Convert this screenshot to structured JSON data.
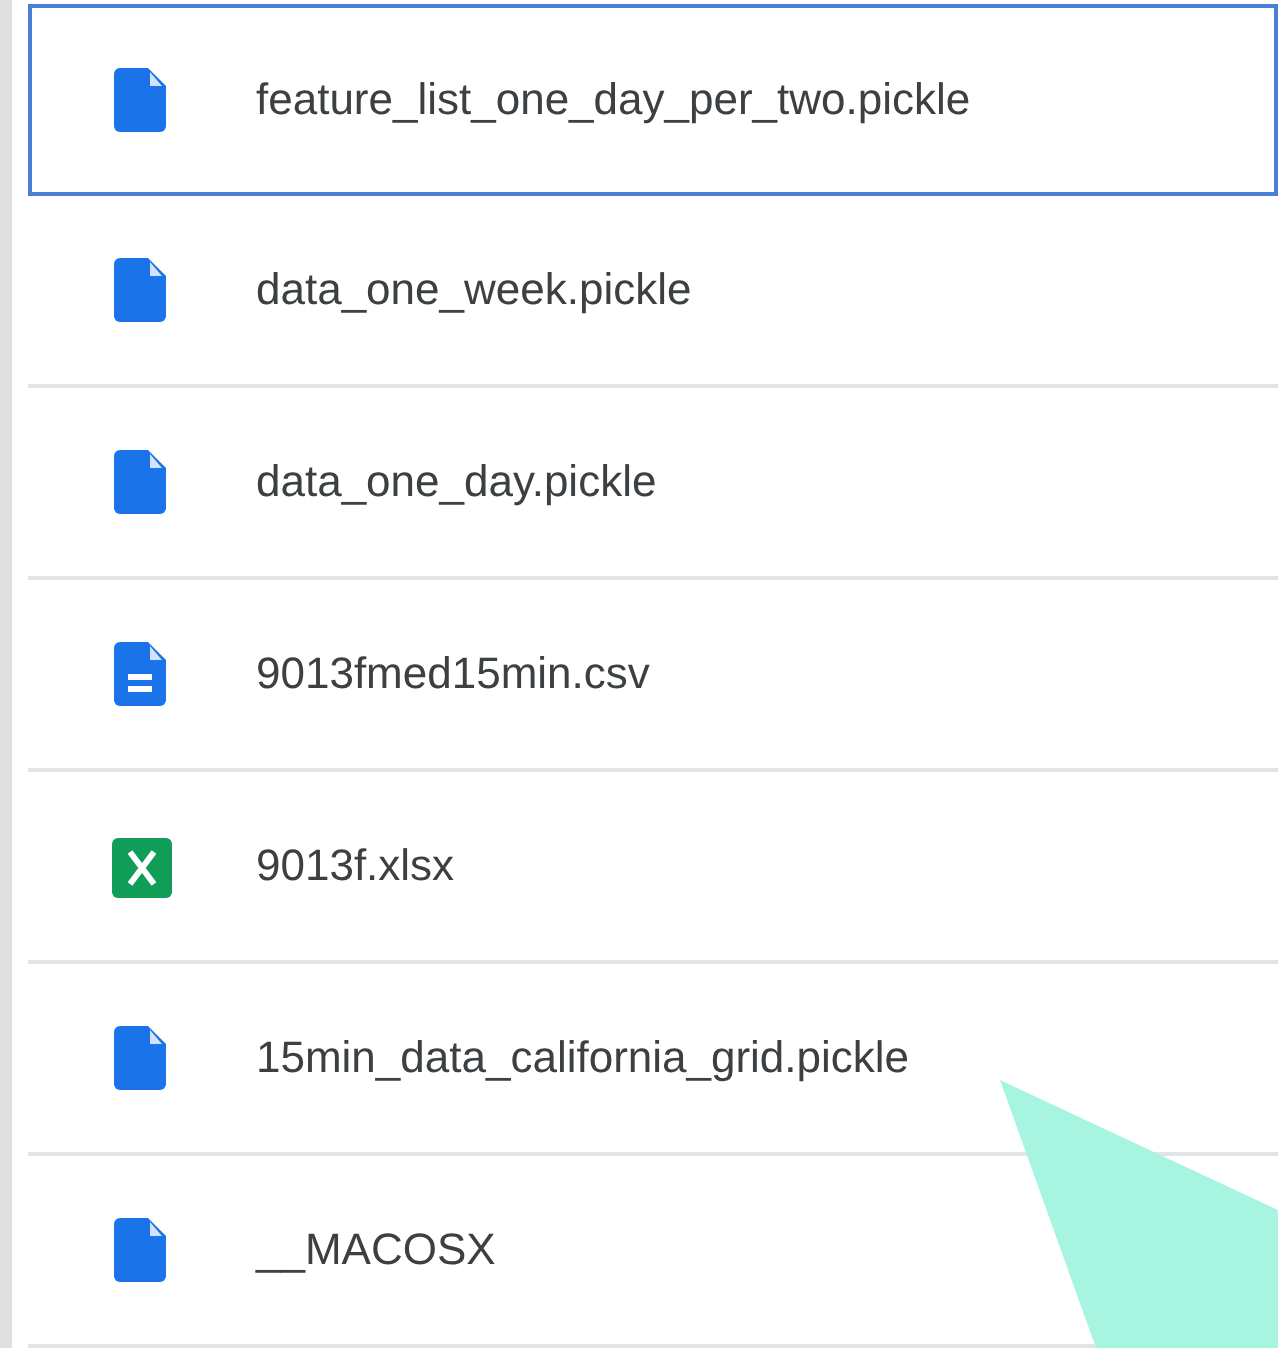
{
  "files": [
    {
      "name": "feature_list_one_day_per_two.pickle",
      "kind": "file",
      "selected": true
    },
    {
      "name": "data_one_week.pickle",
      "kind": "file",
      "selected": false
    },
    {
      "name": "data_one_day.pickle",
      "kind": "file",
      "selected": false
    },
    {
      "name": "9013fmed15min.csv",
      "kind": "doc",
      "selected": false
    },
    {
      "name": "9013f.xlsx",
      "kind": "sheet",
      "selected": false
    },
    {
      "name": "15min_data_california_grid.pickle",
      "kind": "file",
      "selected": false
    },
    {
      "name": "__MACOSX",
      "kind": "file",
      "selected": false
    }
  ]
}
